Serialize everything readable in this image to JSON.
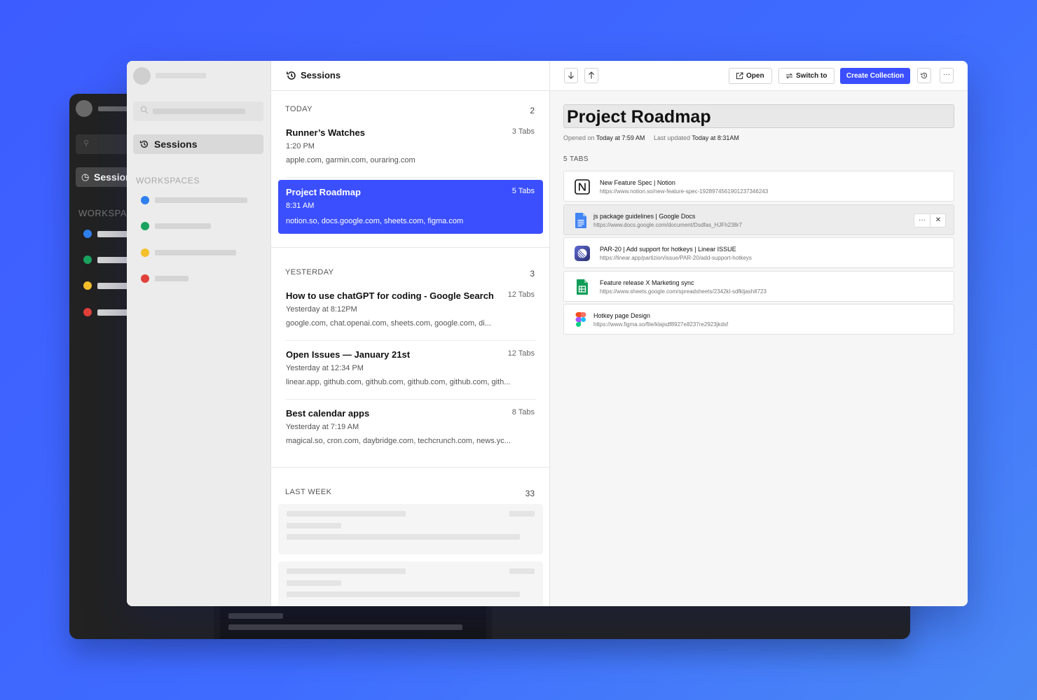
{
  "sidebar": {
    "sessions_label": "Sessions",
    "workspaces_label": "WORKSPACES",
    "workspace_colors": [
      "#2f80ed",
      "#1aa35f",
      "#f5c02b",
      "#e0413a"
    ]
  },
  "back_window": {
    "sessions_label": "Sessions",
    "workspaces_label": "WORKSPACES"
  },
  "list": {
    "header": "Sessions",
    "groups": [
      {
        "label": "TODAY",
        "count": "2",
        "sessions": [
          {
            "title": "Runner’s Watches",
            "tabs": "3 Tabs",
            "time": "1:20 PM",
            "domains": "apple.com, garmin.com, ouraring.com"
          },
          {
            "title": "Project Roadmap",
            "tabs": "5 Tabs",
            "time": "8:31 AM",
            "domains": "notion.so, docs.google.com, sheets.com, figma.com"
          }
        ]
      },
      {
        "label": "YESTERDAY",
        "count": "3",
        "sessions": [
          {
            "title": "How to use chatGPT for coding - Google Search",
            "tabs": "12 Tabs",
            "time": "Yesterday at 8:12PM",
            "domains": "google.com, chat.openai.com, sheets.com, google.com, di..."
          },
          {
            "title": "Open Issues — January 21st",
            "tabs": "12 Tabs",
            "time": "Yesterday at 12:34 PM",
            "domains": "linear.app, github.com, github.com, github.com, github.com, gith..."
          },
          {
            "title": "Best calendar apps",
            "tabs": "8 Tabs",
            "time": "Yesterday at 7:19 AM",
            "domains": "magical.so, cron.com, daybridge.com, techcrunch.com, news.yc..."
          }
        ]
      },
      {
        "label": "LAST WEEK",
        "count": "33"
      }
    ]
  },
  "toolbar": {
    "open_label": "Open",
    "switch_label": "Switch to",
    "create_label": "Create Collection",
    "more_label": "···"
  },
  "detail": {
    "title": "Project Roadmap",
    "opened_prefix": "Opened on",
    "opened_value": "Today at 7:59 AM",
    "updated_prefix": "Last updated",
    "updated_value": "Today at 8:31AM",
    "tabs_count_label": "5 TABS",
    "tabs": [
      {
        "title": "New Feature Spec | Notion",
        "url": "https://www.notion.so/new-feature-spec-1928974561901237346243",
        "icon": "notion-icon"
      },
      {
        "title": "js package guidelines | Google Docs",
        "url": "https://www.docs.google.com/document/Dsdfas_HJFh238r7",
        "icon": "google-docs-icon"
      },
      {
        "title": "PAR-20 | Add support for hotkeys | Linear ISSUE",
        "url": "https://linear.app/partizion/issue/PAR-20/add-support-hotkeys",
        "icon": "linear-icon"
      },
      {
        "title": "Feature release X Marketing sync",
        "url": "https://www.sheets.google.com/spreadsheets/2342kl-sdfkljash8723",
        "icon": "google-sheets-icon"
      },
      {
        "title": "Hotkey page Design",
        "url": "https://www.figma.so/file/klajsdf8927e8237re2923jkdsf",
        "icon": "figma-icon"
      }
    ],
    "tab_actions": {
      "more": "···",
      "close": "✕"
    }
  }
}
